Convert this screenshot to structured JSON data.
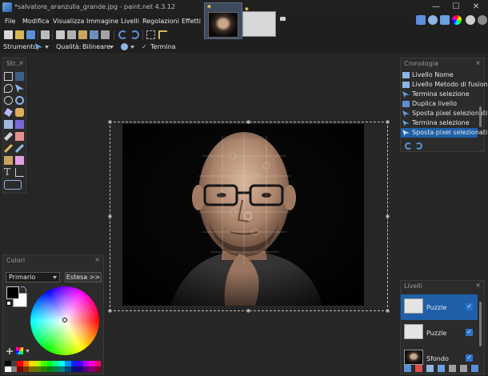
{
  "window": {
    "title": "*salvatore_aranzulla_grande.jpg - paint.net 4.3.12",
    "minimize": "—",
    "maximize": "☐",
    "close": "✕"
  },
  "menu": [
    "File",
    "Modifica",
    "Visualizza",
    "Immagine",
    "Livelli",
    "Regolazioni",
    "Effetti"
  ],
  "options_bar": {
    "tool_label": "Strumento:",
    "quality_label": "Qualità:",
    "quality_value": "Bilineare",
    "finish_label": "Termina"
  },
  "tools_panel": {
    "title": "Str..."
  },
  "history_panel": {
    "title": "Cronologia",
    "items": [
      "Livello Nome",
      "Livello Metodo di fusione",
      "Termina selezione",
      "Duplica livello",
      "Sposta pixel selezionati",
      "Termina selezione",
      "Sposta pixel selezionati"
    ],
    "selected_index": 6
  },
  "colors_panel": {
    "title": "Colori",
    "mode": "Primario",
    "expand_label": "Estesa >>",
    "primary_color": "#000000",
    "secondary_color": "#ffffff"
  },
  "layers_panel": {
    "title": "Livelli",
    "layers": [
      {
        "name": "Puzzle",
        "selected": true
      },
      {
        "name": "Puzzle",
        "selected": false
      },
      {
        "name": "Sfondo",
        "selected": false
      }
    ]
  },
  "colors": {
    "accent": "#2d73c9",
    "selection": "#1f5fa8"
  }
}
